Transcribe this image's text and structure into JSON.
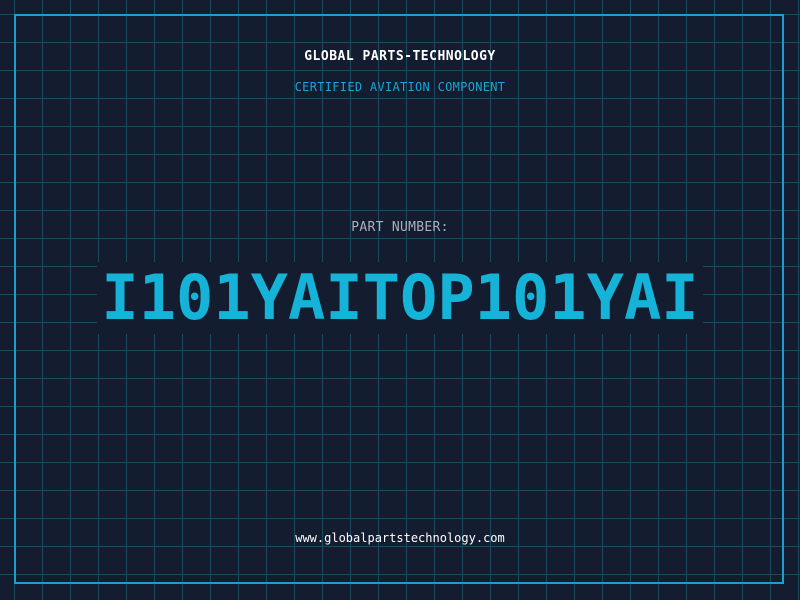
{
  "header": {
    "company": "GLOBAL PARTS-TECHNOLOGY",
    "tagline": "CERTIFIED AVIATION COMPONENT"
  },
  "part": {
    "label": "PART NUMBER:",
    "value": "I101YAITOP101YAI"
  },
  "footer": {
    "url": "www.globalpartstechnology.com"
  },
  "colors": {
    "background": "#141c30",
    "grid": "#1e4a5e",
    "accent": "#16b3d9",
    "border": "#1e9ed0"
  }
}
